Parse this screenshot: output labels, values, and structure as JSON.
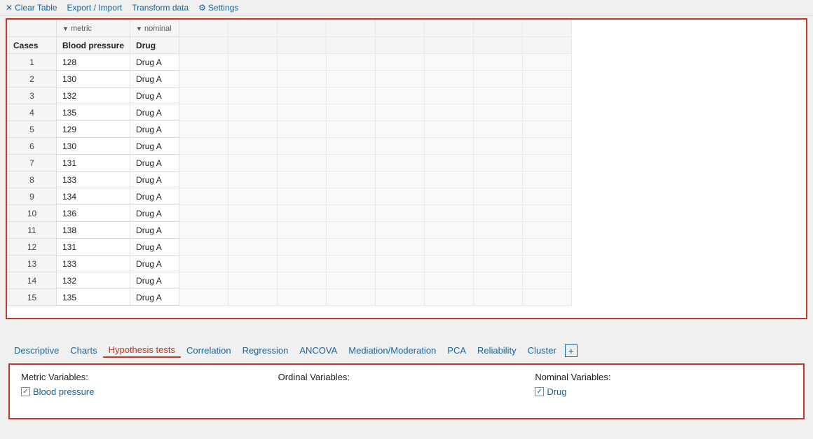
{
  "toolbar": {
    "items": [
      {
        "id": "clear-table",
        "label": "Clear Table",
        "icon": "clear-icon"
      },
      {
        "id": "export-import",
        "label": "Export / Import",
        "icon": "export-icon"
      },
      {
        "id": "transform-data",
        "label": "Transform data",
        "icon": "transform-icon"
      },
      {
        "id": "settings",
        "label": "Settings",
        "icon": "settings-icon"
      }
    ]
  },
  "table": {
    "columns": [
      {
        "id": "cases",
        "label": "Cases",
        "type": ""
      },
      {
        "id": "blood-pressure",
        "label": "Blood pressure",
        "type": "metric"
      },
      {
        "id": "drug",
        "label": "Drug",
        "type": "nominal"
      }
    ],
    "empty_columns": 8,
    "rows": [
      {
        "case": 1,
        "blood_pressure": 128,
        "drug": "Drug A"
      },
      {
        "case": 2,
        "blood_pressure": 130,
        "drug": "Drug A"
      },
      {
        "case": 3,
        "blood_pressure": 132,
        "drug": "Drug A"
      },
      {
        "case": 4,
        "blood_pressure": 135,
        "drug": "Drug A"
      },
      {
        "case": 5,
        "blood_pressure": 129,
        "drug": "Drug A"
      },
      {
        "case": 6,
        "blood_pressure": 130,
        "drug": "Drug A"
      },
      {
        "case": 7,
        "blood_pressure": 131,
        "drug": "Drug A"
      },
      {
        "case": 8,
        "blood_pressure": 133,
        "drug": "Drug A"
      },
      {
        "case": 9,
        "blood_pressure": 134,
        "drug": "Drug A"
      },
      {
        "case": 10,
        "blood_pressure": 136,
        "drug": "Drug A"
      },
      {
        "case": 11,
        "blood_pressure": 138,
        "drug": "Drug A"
      },
      {
        "case": 12,
        "blood_pressure": 131,
        "drug": "Drug A"
      },
      {
        "case": 13,
        "blood_pressure": 133,
        "drug": "Drug A"
      },
      {
        "case": 14,
        "blood_pressure": 132,
        "drug": "Drug A"
      },
      {
        "case": 15,
        "blood_pressure": 135,
        "drug": "Drug A"
      }
    ]
  },
  "nav_tabs": [
    {
      "id": "descriptive",
      "label": "Descriptive",
      "active": false
    },
    {
      "id": "charts",
      "label": "Charts",
      "active": false
    },
    {
      "id": "hypothesis-tests",
      "label": "Hypothesis tests",
      "active": true
    },
    {
      "id": "correlation",
      "label": "Correlation",
      "active": false
    },
    {
      "id": "regression",
      "label": "Regression",
      "active": false
    },
    {
      "id": "ancova",
      "label": "ANCOVA",
      "active": false
    },
    {
      "id": "mediation-moderation",
      "label": "Mediation/Moderation",
      "active": false
    },
    {
      "id": "pca",
      "label": "PCA",
      "active": false
    },
    {
      "id": "reliability",
      "label": "Reliability",
      "active": false
    },
    {
      "id": "cluster",
      "label": "Cluster",
      "active": false
    }
  ],
  "variables": {
    "metric_label": "Metric Variables:",
    "ordinal_label": "Ordinal Variables:",
    "nominal_label": "Nominal Variables:",
    "metric_vars": [
      {
        "id": "blood-pressure",
        "label": "Blood pressure",
        "checked": true
      }
    ],
    "ordinal_vars": [],
    "nominal_vars": [
      {
        "id": "drug",
        "label": "Drug",
        "checked": true
      }
    ]
  }
}
